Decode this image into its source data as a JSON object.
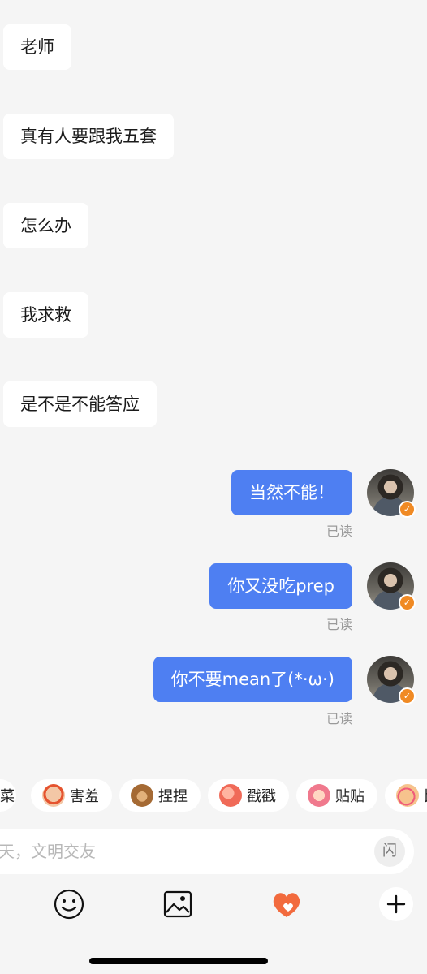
{
  "messages_in": [
    {
      "text": "老师"
    },
    {
      "text": "真有人要跟我五套"
    },
    {
      "text": "怎么办"
    },
    {
      "text": "我求救"
    },
    {
      "text": "是不是不能答应"
    }
  ],
  "messages_out": [
    {
      "text": "当然不能！",
      "status": "已读"
    },
    {
      "text": "你又没吃prep",
      "status": "已读"
    },
    {
      "text": "你不要mean了(*·ω·)",
      "status": "已读"
    }
  ],
  "quick_reactions": [
    {
      "label": "菜",
      "icon": "food-icon"
    },
    {
      "label": "害羞",
      "icon": "shy-face-icon"
    },
    {
      "label": "捏捏",
      "icon": "bear-icon"
    },
    {
      "label": "戳戳",
      "icon": "peach-icon"
    },
    {
      "label": "贴贴",
      "icon": "hug-icon"
    },
    {
      "label": "比",
      "icon": "finger-heart-icon"
    }
  ],
  "input": {
    "placeholder": "聊天，文明交友",
    "flash_label": "闪"
  },
  "toolbar": {
    "emoji_icon": "smiley-icon",
    "image_icon": "image-icon",
    "heart_icon": "heart-icon",
    "plus_icon": "plus-icon"
  },
  "colors": {
    "outgoing_bubble": "#4e7ff2",
    "incoming_bubble": "#ffffff",
    "background": "#f5f5f5",
    "verified_badge": "#f08a24",
    "heart": "#f26a3d"
  }
}
